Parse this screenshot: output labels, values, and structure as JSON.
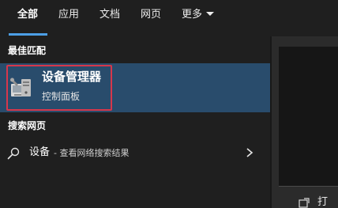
{
  "tabs": {
    "all": "全部",
    "apps": "应用",
    "documents": "文档",
    "web": "网页",
    "more": "更多"
  },
  "best_match": {
    "section_title": "最佳匹配",
    "app_name": "设备管理器",
    "app_subtitle": "控制面板",
    "icon": "device-manager-icon"
  },
  "web_search": {
    "section_title": "搜索网页",
    "keyword": "设备",
    "description": "- 查看网络搜索结果",
    "icon": "search-icon"
  },
  "preview": {
    "action_label": "打"
  },
  "colors": {
    "accent": "#4c9fe6",
    "selection_bg": "#294c6c",
    "highlight_border": "#d7374b",
    "background": "#1f1f1f"
  }
}
